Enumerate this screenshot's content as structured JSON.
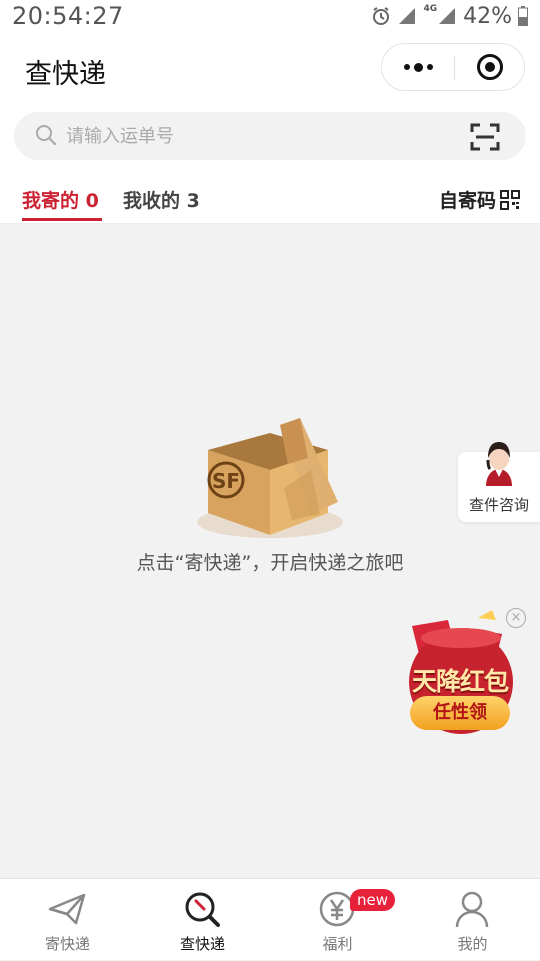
{
  "status_bar": {
    "time": "20:54:27",
    "battery": "42%",
    "network": "4G"
  },
  "navbar": {
    "title": "查快递"
  },
  "search": {
    "placeholder": "请输入运单号",
    "value": ""
  },
  "tabs": [
    {
      "label": "我寄的 0",
      "active": true
    },
    {
      "label": "我收的 3",
      "active": false
    }
  ],
  "self_code": {
    "label": "自寄码"
  },
  "empty_state": {
    "text": "点击“寄快递”，开启快递之旅吧",
    "box_logo": "SF"
  },
  "consult": {
    "label": "查件咨询"
  },
  "red_packet": {
    "title": "天降红包",
    "subtitle": "任性领"
  },
  "tab_bar": {
    "items": [
      {
        "label": "寄快递",
        "icon": "paper-plane-icon",
        "active": false
      },
      {
        "label": "查快递",
        "icon": "search-package-icon",
        "active": true
      },
      {
        "label": "福利",
        "icon": "yen-coin-icon",
        "active": false,
        "badge": "new"
      },
      {
        "label": "我的",
        "icon": "person-icon",
        "active": false
      }
    ]
  },
  "colors": {
    "accent": "#cc2233",
    "background": "#f2f2f2",
    "badge": "#e8213a"
  }
}
